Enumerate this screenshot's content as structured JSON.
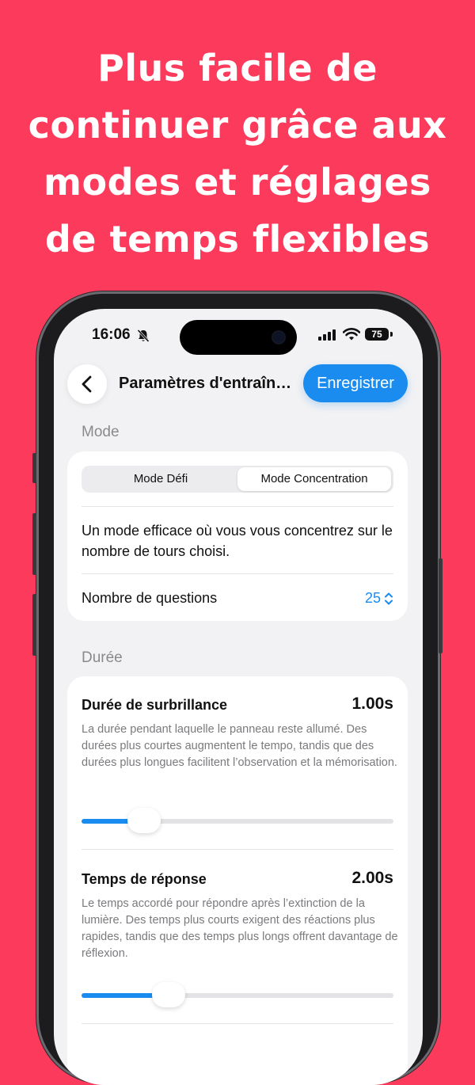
{
  "headline": {
    "lines": [
      "Plus facile de",
      "continuer grâce aux",
      "modes et réglages",
      "de temps flexibles"
    ]
  },
  "status_bar": {
    "time": "16:06",
    "battery": "75"
  },
  "nav": {
    "title": "Paramètres d'entraîn…",
    "save_label": "Enregistrer"
  },
  "mode_section": {
    "label": "Mode",
    "segments": [
      {
        "label": "Mode Défi",
        "selected": false
      },
      {
        "label": "Mode Concentration",
        "selected": true
      }
    ],
    "description": "Un mode efficace où vous vous concentrez sur le nombre de tours choisi.",
    "questions_label": "Nombre de questions",
    "questions_value": "25"
  },
  "duration_section": {
    "label": "Durée",
    "settings": [
      {
        "title": "Durée de surbrillance",
        "value": "1.00s",
        "description": "La durée pendant laquelle le panneau reste allumé. Des durées plus courtes augmentent le tempo, tandis que des durées plus longues facilitent l’observation et la mémorisation.",
        "slider_fraction": 0.2
      },
      {
        "title": "Temps de réponse",
        "value": "2.00s",
        "description": "Le temps accordé pour répondre après l’extinction de la lumière. Des temps plus courts exigent des réactions plus rapides, tandis que des temps plus longs offrent davantage de réflexion.",
        "slider_fraction": 0.28
      }
    ]
  },
  "colors": {
    "background": "#fc3a5c",
    "accent": "#1a8cf0"
  }
}
